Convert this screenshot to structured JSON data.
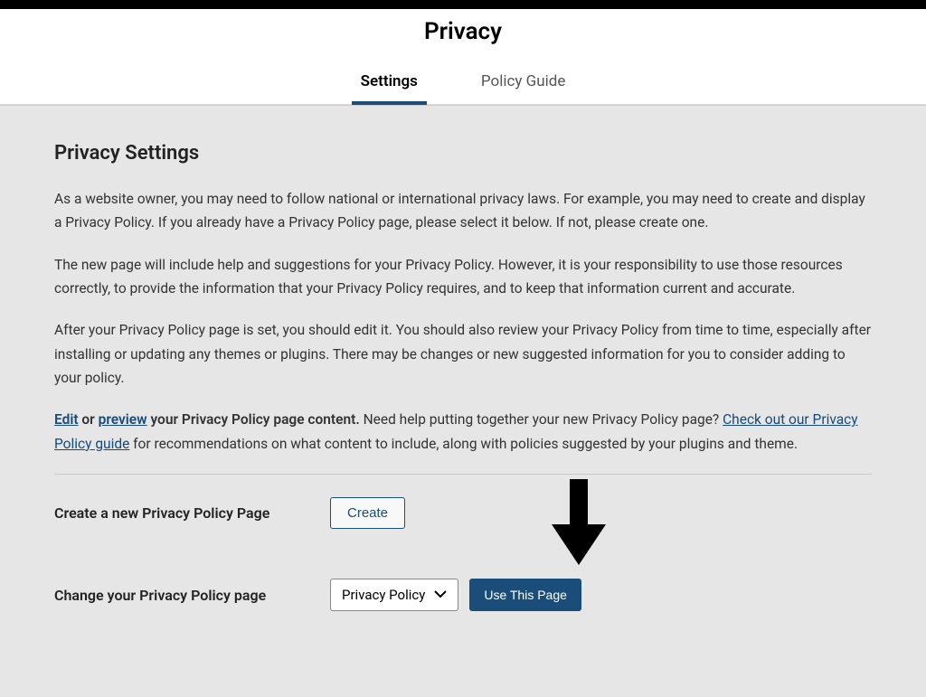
{
  "header": {
    "title": "Privacy"
  },
  "tabs": {
    "settings": "Settings",
    "policy_guide": "Policy Guide"
  },
  "content": {
    "section_title": "Privacy Settings",
    "para1": "As a website owner, you may need to follow national or international privacy laws. For example, you may need to create and display a Privacy Policy. If you already have a Privacy Policy page, please select it below. If not, please create one.",
    "para2": "The new page will include help and suggestions for your Privacy Policy. However, it is your responsibility to use those resources correctly, to provide the information that your Privacy Policy requires, and to keep that information current and accurate.",
    "para3": "After your Privacy Policy page is set, you should edit it. You should also review your Privacy Policy from time to time, especially after installing or updating any themes or plugins. There may be changes or new suggested information for you to consider adding to your policy.",
    "para4_edit": "Edit",
    "para4_or": " or ",
    "para4_preview": "preview",
    "para4_mid": " your Privacy Policy page content.",
    "para4_rest": " Need help putting together your new Privacy Policy page? ",
    "para4_guide_link": "Check out our Privacy Policy guide",
    "para4_end": " for recommendations on what content to include, along with policies suggested by your plugins and theme."
  },
  "forms": {
    "create_label": "Create a new Privacy Policy Page",
    "create_button": "Create",
    "change_label": "Change your Privacy Policy page",
    "select_value": "Privacy Policy",
    "use_button": "Use This Page"
  }
}
